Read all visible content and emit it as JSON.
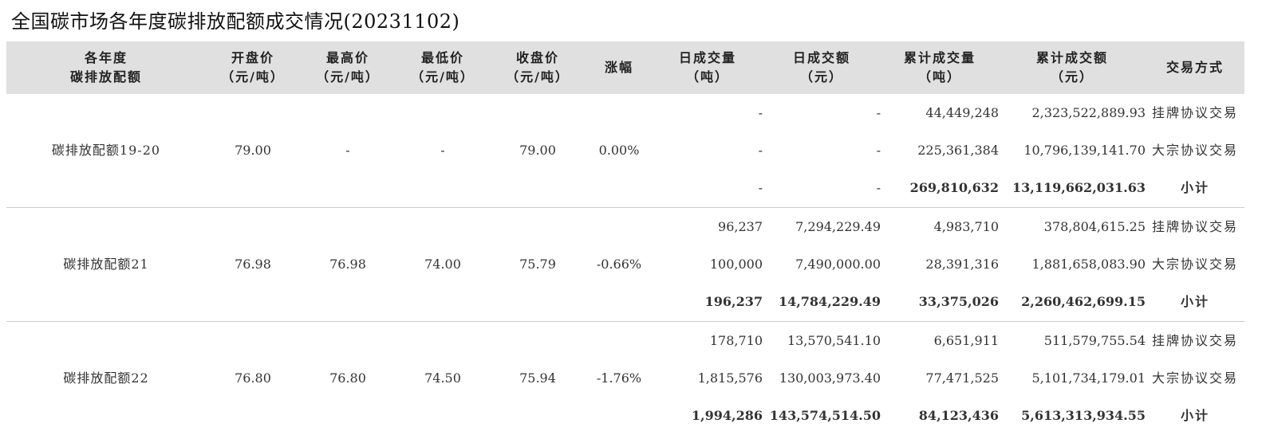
{
  "title": "全国碳市场各年度碳排放配额成交情况(20231102)",
  "header": {
    "col1": [
      "各年度",
      "碳排放配额"
    ],
    "col2": [
      "开盘价",
      "（元/吨）"
    ],
    "col3": [
      "最高价",
      "（元/吨）"
    ],
    "col4": [
      "最低价",
      "（元/吨）"
    ],
    "col5": [
      "收盘价",
      "（元/吨）"
    ],
    "col6": [
      "涨幅"
    ],
    "col7": [
      "日成交量",
      "（吨）"
    ],
    "col8": [
      "日成交额",
      "（元）"
    ],
    "col9": [
      "累计成交量",
      "（吨）"
    ],
    "col10": [
      "累计成交额",
      "（元）"
    ],
    "col11": [
      "交易方式"
    ]
  },
  "groups": [
    {
      "name": "碳排放配额19-20",
      "open": "79.00",
      "high": "-",
      "low": "-",
      "close": "79.00",
      "change": "0.00%",
      "rows": [
        {
          "day_vol": "-",
          "day_amt": "-",
          "cum_vol": "44,449,248",
          "cum_amt": "2,323,522,889.93",
          "method": "挂牌协议交易"
        },
        {
          "day_vol": "-",
          "day_amt": "-",
          "cum_vol": "225,361,384",
          "cum_amt": "10,796,139,141.70",
          "method": "大宗协议交易"
        },
        {
          "day_vol": "-",
          "day_amt": "-",
          "cum_vol": "269,810,632",
          "cum_amt": "13,119,662,031.63",
          "method": "小计"
        }
      ]
    },
    {
      "name": "碳排放配额21",
      "open": "76.98",
      "high": "76.98",
      "low": "74.00",
      "close": "75.79",
      "change": "-0.66%",
      "rows": [
        {
          "day_vol": "96,237",
          "day_amt": "7,294,229.49",
          "cum_vol": "4,983,710",
          "cum_amt": "378,804,615.25",
          "method": "挂牌协议交易"
        },
        {
          "day_vol": "100,000",
          "day_amt": "7,490,000.00",
          "cum_vol": "28,391,316",
          "cum_amt": "1,881,658,083.90",
          "method": "大宗协议交易"
        },
        {
          "day_vol": "196,237",
          "day_amt": "14,784,229.49",
          "cum_vol": "33,375,026",
          "cum_amt": "2,260,462,699.15",
          "method": "小计"
        }
      ]
    },
    {
      "name": "碳排放配额22",
      "open": "76.80",
      "high": "76.80",
      "low": "74.50",
      "close": "75.94",
      "change": "-1.76%",
      "rows": [
        {
          "day_vol": "178,710",
          "day_amt": "13,570,541.10",
          "cum_vol": "6,651,911",
          "cum_amt": "511,579,755.54",
          "method": "挂牌协议交易"
        },
        {
          "day_vol": "1,815,576",
          "day_amt": "130,003,973.40",
          "cum_vol": "77,471,525",
          "cum_amt": "5,101,734,179.01",
          "method": "大宗协议交易"
        },
        {
          "day_vol": "1,994,286",
          "day_amt": "143,574,514.50",
          "cum_vol": "84,123,436",
          "cum_amt": "5,613,313,934.55",
          "method": "小计"
        }
      ]
    }
  ]
}
